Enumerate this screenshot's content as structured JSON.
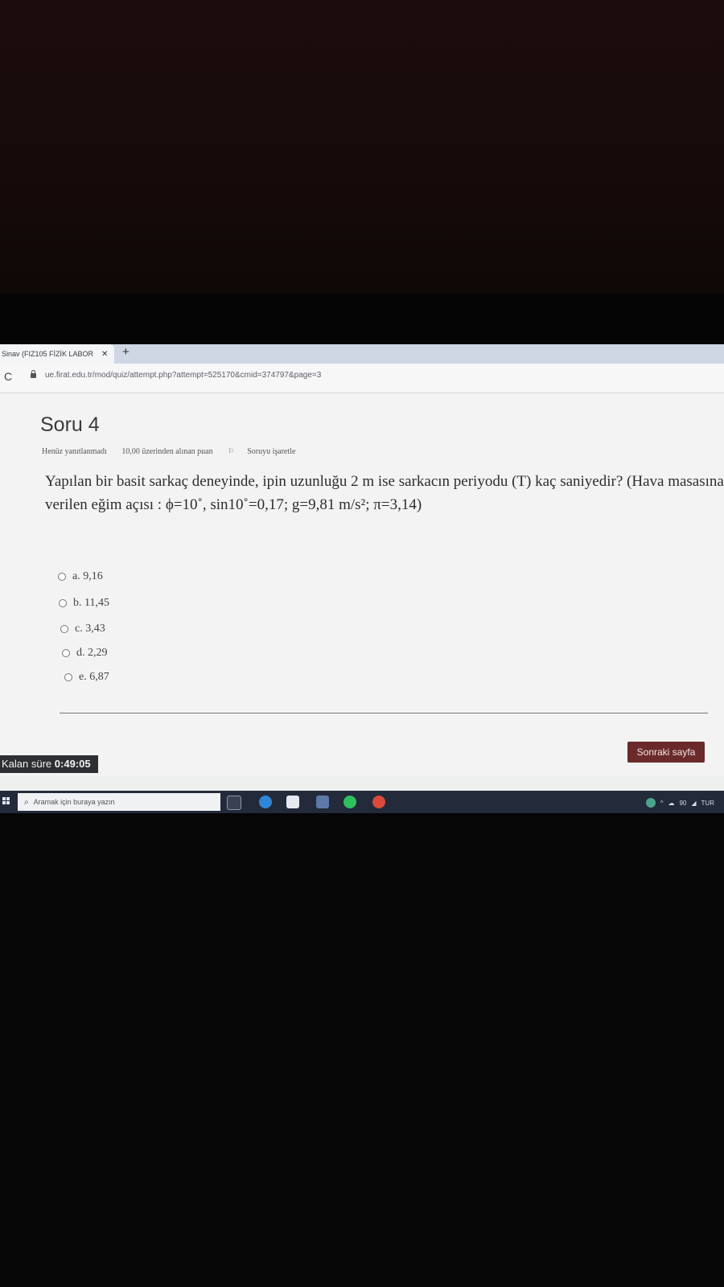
{
  "browser": {
    "tab_title": "Sinav (FIZ105 FİZİK LABOR",
    "tab_close": "✕",
    "new_tab": "+",
    "reload": "C",
    "url": "ue.firat.edu.tr/mod/quiz/attempt.php?attempt=525170&cmid=374797&page=3"
  },
  "question": {
    "title": "Soru 4",
    "status": "Henüz yanıtlanmadı",
    "points": "10,00 üzerinden alınan puan",
    "flag_label": "Soruyu işaretle",
    "text": "Yapılan bir basit sarkaç deneyinde, ipin uzunluğu 2 m ise sarkacın periyodu (T) kaç saniyedir? (Hava masasına verilen eğim açısı : ϕ=10˚, sin10˚=0,17; g=9,81 m/s²; π=3,14)",
    "options": [
      "a. 9,16",
      "b. 11,45",
      "c. 3,43",
      "d. 2,29",
      "e. 6,87"
    ]
  },
  "navigation": {
    "next_label": "Sonraki sayfa"
  },
  "timer": {
    "label": "Kalan süre",
    "value": "0:49:05"
  },
  "taskbar": {
    "search_placeholder": "Aramak için buraya yazın",
    "tray_lang": "TUR",
    "tray_temp": "90"
  },
  "colors": {
    "next_button": "#6b2a2a",
    "timer_bg": "#2d2f33",
    "taskbar_bg": "#232a3a"
  }
}
